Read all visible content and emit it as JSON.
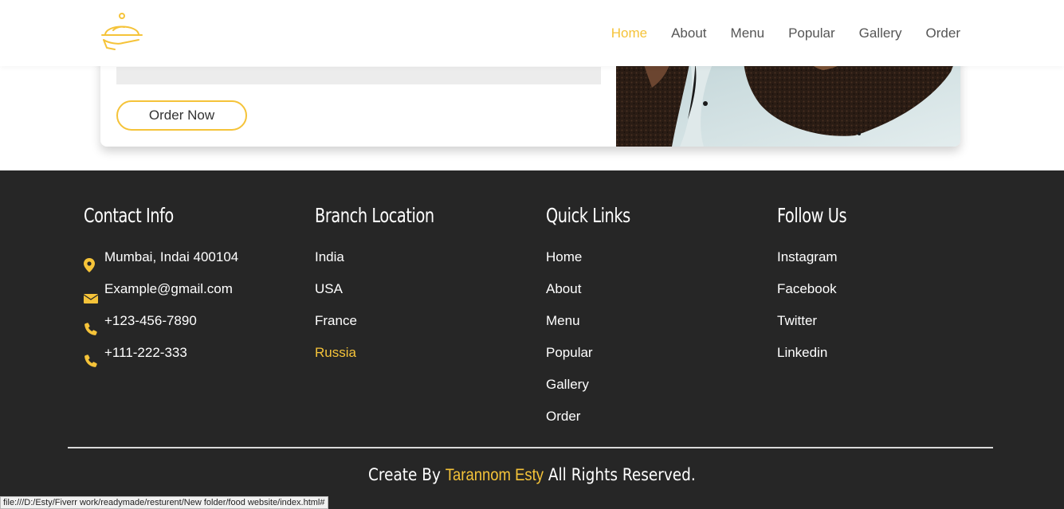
{
  "header": {
    "logo_icon": "serving-cloche-icon",
    "nav": [
      {
        "label": "Home",
        "active": true
      },
      {
        "label": "About",
        "active": false
      },
      {
        "label": "Menu",
        "active": false
      },
      {
        "label": "Popular",
        "active": false
      },
      {
        "label": "Gallery",
        "active": false
      },
      {
        "label": "Order",
        "active": false
      }
    ]
  },
  "card": {
    "order_button": "Order Now"
  },
  "footer": {
    "contact": {
      "title": "Contact Info",
      "items": [
        {
          "icon": "map-marker-icon",
          "text": "Mumbai, Indai 400104"
        },
        {
          "icon": "envelope-icon",
          "text": "Example@gmail.com"
        },
        {
          "icon": "phone-icon",
          "text": "+123-456-7890"
        },
        {
          "icon": "phone-icon",
          "text": "+111-222-333"
        }
      ]
    },
    "branch": {
      "title": "Branch Location",
      "items": [
        "India",
        "USA",
        "France",
        "Russia"
      ]
    },
    "quick_links": {
      "title": "Quick Links",
      "items": [
        "Home",
        "About",
        "Menu",
        "Popular",
        "Gallery",
        "Order"
      ]
    },
    "follow": {
      "title": "Follow Us",
      "items": [
        "Instagram",
        "Facebook",
        "Twitter",
        "Linkedin"
      ]
    },
    "credit": {
      "prefix": "Create By ",
      "name": "Tarannom Esty",
      "suffix": " All Rights Reserved."
    }
  },
  "status_bar": {
    "url": "file:///D:/Esty/Fiverr work/readymade/resturent/New folder/food website/index.html#"
  },
  "colors": {
    "accent": "#f5c339",
    "footer_bg": "#262626"
  }
}
